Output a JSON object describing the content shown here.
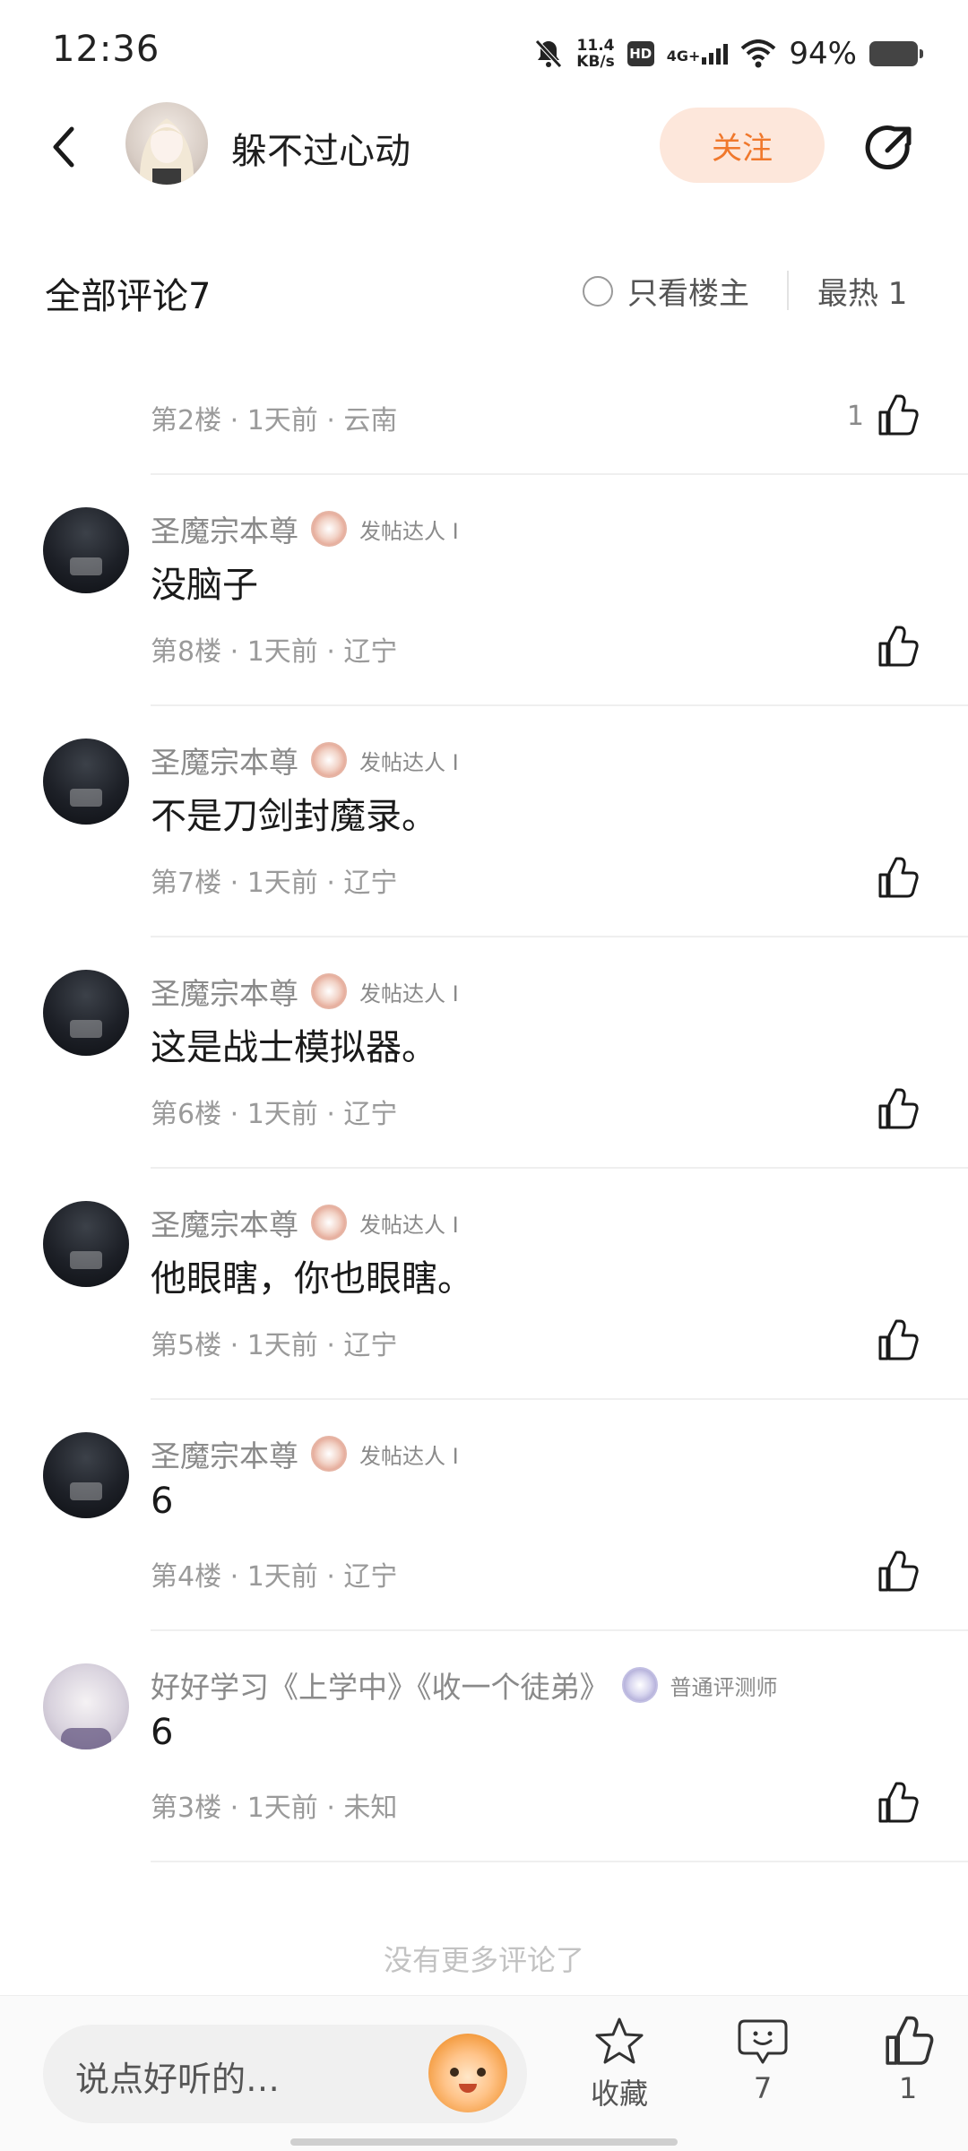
{
  "status_bar": {
    "time": "12:36",
    "net_speed_value": "11.4",
    "net_speed_unit": "KB/s",
    "hd": "HD",
    "network": "4G+",
    "battery": "94%"
  },
  "nav": {
    "title": "躲不过心动",
    "follow_label": "关注"
  },
  "header": {
    "title": "全部评论7",
    "only_op_label": "只看楼主",
    "sort_label": "最热 1"
  },
  "comments": [
    {
      "name": "",
      "badge": "",
      "text": "",
      "meta": "第2楼 · 1天前 · 云南",
      "likes": "1"
    },
    {
      "name": "圣魔宗本尊",
      "badge": "发帖达人 I",
      "text": "没脑子",
      "meta": "第8楼 · 1天前 · 辽宁",
      "likes": ""
    },
    {
      "name": "圣魔宗本尊",
      "badge": "发帖达人 I",
      "text": "不是刀剑封魔录。",
      "meta": "第7楼 · 1天前 · 辽宁",
      "likes": ""
    },
    {
      "name": "圣魔宗本尊",
      "badge": "发帖达人 I",
      "text": "这是战士模拟器。",
      "meta": "第6楼 · 1天前 · 辽宁",
      "likes": ""
    },
    {
      "name": "圣魔宗本尊",
      "badge": "发帖达人 I",
      "text": "他眼瞎，你也眼瞎。",
      "meta": "第5楼 · 1天前 · 辽宁",
      "likes": ""
    },
    {
      "name": "圣魔宗本尊",
      "badge": "发帖达人 I",
      "text": "6",
      "meta": "第4楼 · 1天前 · 辽宁",
      "likes": ""
    },
    {
      "name": "好好学习《上学中》《收一个徒弟》",
      "badge": "普通评测师",
      "text": "6",
      "meta": "第3楼 · 1天前 · 未知",
      "likes": ""
    }
  ],
  "footer_note": "没有更多评论了",
  "bottom_bar": {
    "input_placeholder": "说点好听的…",
    "favorite_label": "收藏",
    "comment_count": "7",
    "like_count": "1"
  },
  "colors": {
    "accent": "#f0782c",
    "follow_bg": "#fde7db",
    "meta_text": "#9a9a9a"
  }
}
